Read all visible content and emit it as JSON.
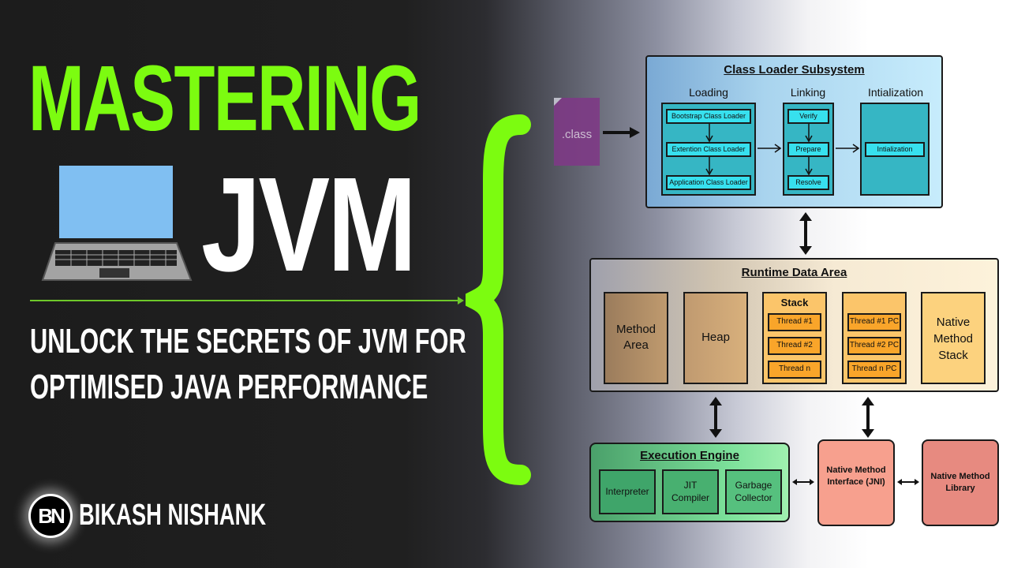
{
  "hero": {
    "title_line1": "MASTERING",
    "title_line2": "JVM",
    "subtitle_line1": "UNLOCK THE SECRETS OF JVM FOR",
    "subtitle_line2": "OPTIMISED JAVA PERFORMANCE",
    "accent_color": "#7cfc10"
  },
  "author": {
    "logo_text": "BN",
    "name": "BIKASH NISHANK"
  },
  "diagram": {
    "class_file": ".class",
    "class_loader": {
      "title": "Class Loader Subsystem",
      "loading": {
        "label": "Loading",
        "items": [
          "Bootstrap Class Loader",
          "Extention Class Loader",
          "Application Class Loader"
        ]
      },
      "linking": {
        "label": "Linking",
        "items": [
          "Verify",
          "Prepare",
          "Resolve"
        ]
      },
      "initialization": {
        "label": "Intialization",
        "items": [
          "Intialization"
        ]
      }
    },
    "runtime_data_area": {
      "title": "Runtime Data Area",
      "method_area": "Method Area",
      "heap": "Heap",
      "stack": {
        "label": "Stack",
        "items": [
          "Thread #1",
          "Thread #2",
          "Thread n"
        ]
      },
      "pc_registers": {
        "items": [
          "Thread #1 PC",
          "Thread #2 PC",
          "Thread n PC"
        ]
      },
      "native_method_stack": "Native Method Stack"
    },
    "execution_engine": {
      "title": "Execution Engine",
      "items": [
        "Interpreter",
        "JIT Compiler",
        "Garbage Collector"
      ]
    },
    "jni": "Native Method Interface (JNI)",
    "native_library": "Native Method Library"
  }
}
